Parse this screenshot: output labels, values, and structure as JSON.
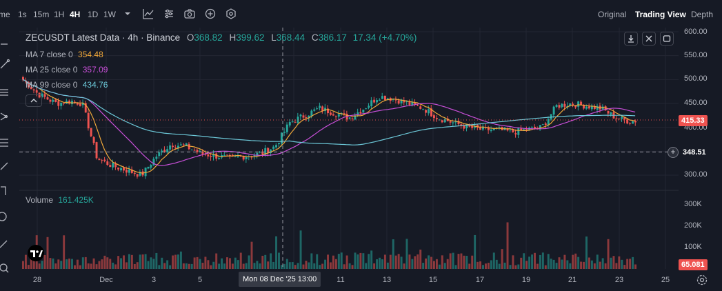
{
  "toolbar": {
    "left_cut": "me",
    "intervals": [
      "1s",
      "15m",
      "1H",
      "4H",
      "1D",
      "1W"
    ],
    "active_interval": "4H",
    "views": [
      "Original",
      "Trading View",
      "Depth"
    ],
    "active_view": "Trading View"
  },
  "legend": {
    "title": "ZECUSDT Latest Data · 4h · Binance",
    "o_key": "O",
    "o_val": "368.82",
    "h_key": "H",
    "h_val": "399.62",
    "l_key": "L",
    "l_val": "368.44",
    "c_key": "C",
    "c_val": "386.17",
    "change": "17.34 (+4.70%)",
    "ma7_label": "MA 7 close 0",
    "ma7_val": "354.48",
    "ma25_label": "MA 25 close 0",
    "ma25_val": "357.09",
    "ma99_label": "MA 99 close 0",
    "ma99_val": "434.76",
    "volume_label": "Volume",
    "volume_val": "161.425K"
  },
  "colors": {
    "up": "#26a69a",
    "down": "#ef5350",
    "ma7": "#f0a83a",
    "ma25": "#c84fd8",
    "ma99": "#6cc8d8",
    "background": "#161a25"
  },
  "price_scale": {
    "ticks": [
      "600.00",
      "550.00",
      "500.00",
      "450.00",
      "400.00",
      "350.00",
      "300.00"
    ],
    "last_price": "415.33",
    "crosshair_price": "348.51"
  },
  "volume_scale": {
    "ticks": [
      "300K",
      "200K",
      "100K"
    ],
    "last_volume": "65.081"
  },
  "time_scale": {
    "ticks": [
      "28",
      "Dec",
      "3",
      "5",
      "11",
      "13",
      "15",
      "17",
      "19",
      "21",
      "23",
      "25"
    ],
    "crosshair_time": "Mon 08 Dec '25    13:00"
  },
  "chart_data": {
    "type": "candlestick",
    "symbol": "ZECUSDT",
    "interval": "4h",
    "y_range": [
      280,
      610
    ],
    "approx_close_path": [
      [
        0,
        500
      ],
      [
        8,
        470
      ],
      [
        18,
        450
      ],
      [
        26,
        455
      ],
      [
        32,
        450
      ],
      [
        40,
        335
      ],
      [
        48,
        320
      ],
      [
        56,
        310
      ],
      [
        64,
        300
      ],
      [
        72,
        340
      ],
      [
        80,
        365
      ],
      [
        88,
        360
      ],
      [
        96,
        345
      ],
      [
        104,
        340
      ],
      [
        112,
        335
      ],
      [
        120,
        340
      ],
      [
        128,
        345
      ],
      [
        136,
        360
      ],
      [
        144,
        410
      ],
      [
        152,
        425
      ],
      [
        160,
        440
      ],
      [
        168,
        430
      ],
      [
        176,
        420
      ],
      [
        184,
        440
      ],
      [
        192,
        465
      ],
      [
        200,
        460
      ],
      [
        208,
        450
      ],
      [
        216,
        440
      ],
      [
        224,
        420
      ],
      [
        232,
        410
      ],
      [
        240,
        400
      ],
      [
        248,
        395
      ],
      [
        256,
        395
      ],
      [
        264,
        390
      ],
      [
        272,
        395
      ],
      [
        280,
        400
      ],
      [
        288,
        445
      ],
      [
        296,
        450
      ],
      [
        304,
        445
      ],
      [
        312,
        440
      ],
      [
        320,
        420
      ],
      [
        328,
        412
      ],
      [
        332,
        415
      ]
    ]
  }
}
